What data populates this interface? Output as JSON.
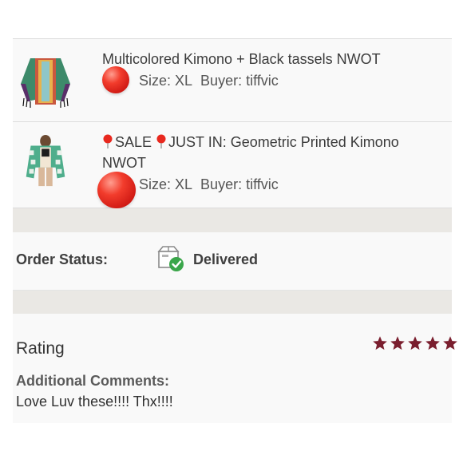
{
  "items": [
    {
      "title": "Multicolored Kimono + Black tassels NWOT",
      "size": "Size: XL",
      "buyer": "Buyer: tiffvic",
      "thumbnail": "kimono-multicolor-thumbnail"
    },
    {
      "title_prefix": "SALE",
      "title_main": "JUST IN: Geometric Printed Kimono NWOT",
      "size": "Size: XL",
      "buyer": "Buyer: tiffvic",
      "thumbnail": "kimono-geometric-thumbnail"
    }
  ],
  "order_status": {
    "label": "Order Status:",
    "value": "Delivered",
    "icon": "package-delivered-icon"
  },
  "rating": {
    "label": "Rating",
    "stars": 5,
    "max_stars": 5
  },
  "comments": {
    "label": "Additional Comments:",
    "text": "Love Luv these!!!! Thx!!!!"
  },
  "colors": {
    "star": "#7a1e2e",
    "balloon": "#e8281e",
    "check": "#3aa64a",
    "band": "#eae8e4",
    "panel": "#f9f9f9"
  }
}
